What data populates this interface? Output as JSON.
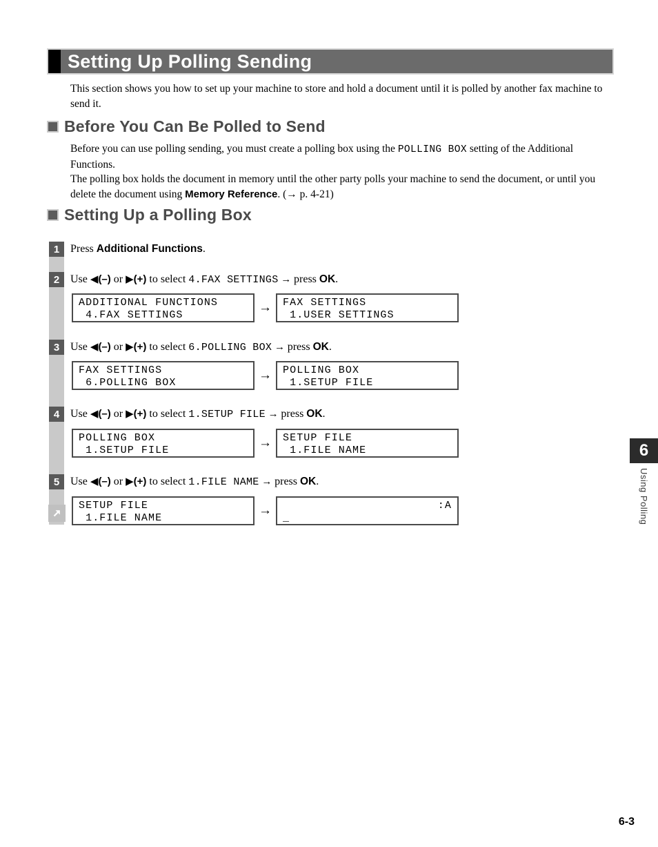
{
  "page": {
    "title": "Setting Up Polling Sending",
    "intro": "This section shows you how to set up your machine to store and hold a document until it is polled by another fax machine to send it.",
    "page_number": "6-3"
  },
  "chapter_tab": {
    "number": "6",
    "label": "Using Polling"
  },
  "sections": [
    {
      "heading": "Before You Can Be Polled to Send",
      "paragraph1_before": "Before you can use polling sending, you must create a polling box using the ",
      "paragraph1_mono": "POLLING BOX",
      "paragraph1_after": " setting of the Additional Functions.",
      "paragraph2_before": "The polling box holds the document in memory until the other party polls your machine to send the document, or until you delete the document using ",
      "paragraph2_bold": "Memory Reference",
      "paragraph2_after": ". (→ p. 4-21)"
    },
    {
      "heading": "Setting Up a Polling Box"
    }
  ],
  "steps": [
    {
      "number": "1",
      "prefix": "Press ",
      "bold": "Additional Functions",
      "suffix": "."
    },
    {
      "number": "2",
      "use": "Use ",
      "left_tri": "◀",
      "minus": "(–)",
      "or": " or ",
      "right_tri": "▶",
      "plus": "(+)",
      "to_select": " to select ",
      "selection": "4.FAX SETTINGS",
      "arrow": " → ",
      "press": "press ",
      "ok": "OK",
      "period": "."
    },
    {
      "number": "3",
      "use": "Use ",
      "left_tri": "◀",
      "minus": "(–)",
      "or": " or ",
      "right_tri": "▶",
      "plus": "(+)",
      "to_select": " to select ",
      "selection": "6.POLLING BOX",
      "arrow": " → ",
      "press": "press ",
      "ok": "OK",
      "period": "."
    },
    {
      "number": "4",
      "use": "Use ",
      "left_tri": "◀",
      "minus": "(–)",
      "or": " or ",
      "right_tri": "▶",
      "plus": "(+)",
      "to_select": " to select ",
      "selection": "1.SETUP FILE",
      "arrow": " → ",
      "press": "press ",
      "ok": "OK",
      "period": "."
    },
    {
      "number": "5",
      "use": "Use ",
      "left_tri": "◀",
      "minus": "(–)",
      "or": " or ",
      "right_tri": "▶",
      "plus": "(+)",
      "to_select": " to select ",
      "selection": "1.FILE NAME",
      "arrow": " → ",
      "press": "press ",
      "ok": "OK",
      "period": "."
    }
  ],
  "lcd_rows": [
    {
      "left": {
        "line1": "ADDITIONAL FUNCTIONS",
        "line2": " 4.FAX SETTINGS"
      },
      "arrow": "→",
      "right": {
        "line1": "FAX SETTINGS",
        "line2": " 1.USER SETTINGS"
      }
    },
    {
      "left": {
        "line1": "FAX SETTINGS",
        "line2": " 6.POLLING BOX"
      },
      "arrow": "→",
      "right": {
        "line1": "POLLING BOX",
        "line2": " 1.SETUP FILE"
      }
    },
    {
      "left": {
        "line1": "POLLING BOX",
        "line2": " 1.SETUP FILE"
      },
      "arrow": "→",
      "right": {
        "line1": "SETUP FILE",
        "line2": " 1.FILE NAME"
      }
    },
    {
      "left": {
        "line1": "SETUP FILE",
        "line2": " 1.FILE NAME"
      },
      "arrow": "→",
      "right": {
        "line1": ":A",
        "line2": "_",
        "line1_align": "right"
      }
    }
  ],
  "colors": {
    "banner_gray": "#6b6b6b",
    "heading_gray": "#4a4a4a",
    "rail_gray": "#c9c9c9",
    "step_box": "#595959",
    "tab_dark": "#2b2b2b"
  }
}
